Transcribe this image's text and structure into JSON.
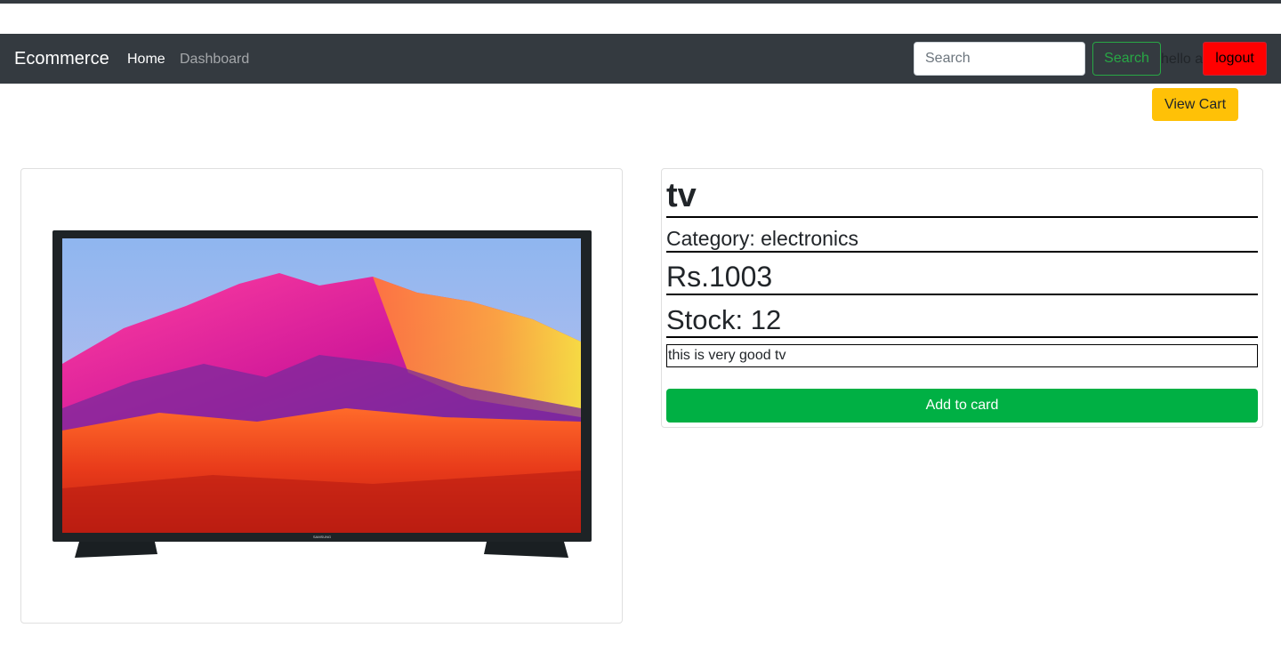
{
  "navbar": {
    "brand": "Ecommerce",
    "links": [
      "Home",
      "Dashboard"
    ],
    "search_placeholder": "Search",
    "search_button": "Search",
    "greeting": "hello a",
    "logout_button": "logout"
  },
  "cart": {
    "view_cart_button": "View Cart"
  },
  "product": {
    "name": "tv",
    "category": "Category: electronics",
    "price": "Rs.1003",
    "stock": "Stock: 12",
    "description": "this is very good tv",
    "add_button": "Add to card",
    "image_icon": "tv-product-image"
  },
  "colors": {
    "navbar_bg": "#343a40",
    "search_outline": "#28a745",
    "logout_bg": "#ff0000",
    "view_cart_bg": "#ffc107",
    "add_button_bg": "#00b044"
  }
}
